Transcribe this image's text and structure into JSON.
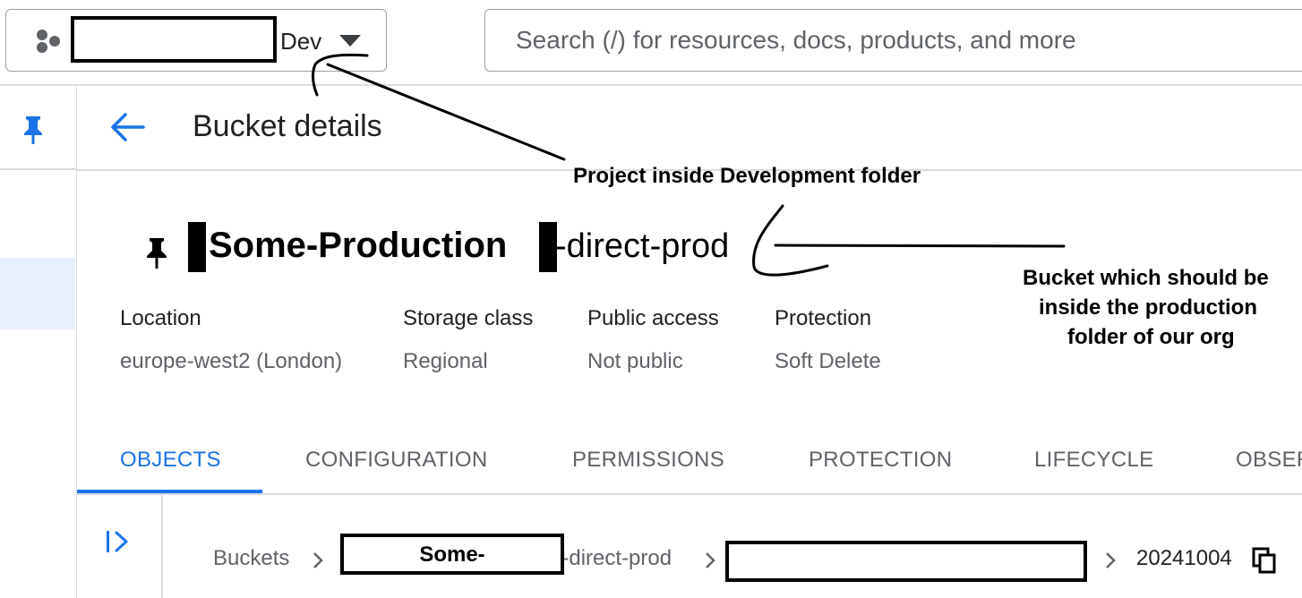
{
  "topbar": {
    "project_suffix": "Dev",
    "search_placeholder": "Search (/) for resources, docs, products, and more"
  },
  "header": {
    "title": "Bucket details"
  },
  "bucket": {
    "name_bold": "Some-Production",
    "name_rest": "-direct-prod"
  },
  "properties": [
    {
      "label": "Location",
      "value": "europe-west2 (London)"
    },
    {
      "label": "Storage class",
      "value": "Regional"
    },
    {
      "label": "Public access",
      "value": "Not public"
    },
    {
      "label": "Protection",
      "value": "Soft Delete"
    }
  ],
  "tabs": [
    {
      "label": "OBJECTS",
      "active": true
    },
    {
      "label": "CONFIGURATION",
      "active": false
    },
    {
      "label": "PERMISSIONS",
      "active": false
    },
    {
      "label": "PROTECTION",
      "active": false
    },
    {
      "label": "LIFECYCLE",
      "active": false
    },
    {
      "label": "OBSER",
      "active": false
    }
  ],
  "breadcrumb": {
    "root": "Buckets",
    "bucket_redacted_text": "Some-",
    "bucket_visible_tail": "g-direct-prod",
    "current": "20241004"
  },
  "annotations": {
    "project_note": "Project inside Development folder",
    "bucket_note_line1": "Bucket which should be",
    "bucket_note_line2": "inside the production",
    "bucket_note_line3": "folder of our org"
  },
  "colors": {
    "accent": "#1a73e8",
    "text_primary": "#202124",
    "text_secondary": "#5f6368",
    "divider": "#dadce0"
  },
  "icons": {
    "project": "hexagon-cluster-icon",
    "dropdown": "caret-down-icon",
    "pin": "pushpin-icon",
    "back": "arrow-left-icon",
    "expand_panel": "expand-panel-icon",
    "chevron": "chevron-right-icon",
    "copy": "copy-icon"
  }
}
